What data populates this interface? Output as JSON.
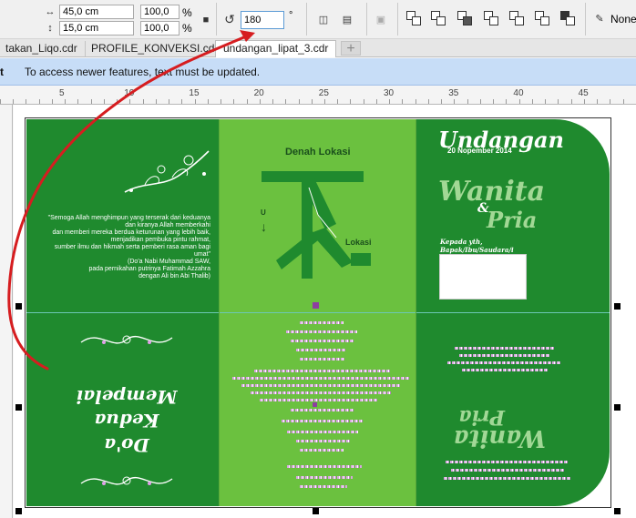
{
  "property_bar": {
    "width_value": "45,0 cm",
    "height_value": "15,0 cm",
    "scale_x": "100,0",
    "scale_y": "100,0",
    "percent_symbol": "%",
    "rotation_value": "180",
    "degree_symbol": "°",
    "none_label": "None"
  },
  "tabs": {
    "items": [
      {
        "label": "takan_Liqo.cdr"
      },
      {
        "label": "PROFILE_KONVEKSI.cdr"
      },
      {
        "label": "undangan_lipat_3.cdr"
      }
    ],
    "add_label": "+"
  },
  "infobar": {
    "prefix": "t",
    "message": "To access newer features, text must be updated."
  },
  "ruler": {
    "labels": [
      "5",
      "10",
      "15",
      "20",
      "25",
      "30",
      "35",
      "40",
      "45"
    ]
  },
  "design": {
    "colors": {
      "dark_green": "#1f8a2e",
      "light_green": "#6bc13f",
      "red_arrow": "#d61d20",
      "purple_handle": "#8d3fa0"
    },
    "doa_text": [
      "\"Semoga Allah  menghimpun yang  terserak dari keduanya",
      "dan kiranya Allah memberkahi",
      "dan memberi mereka berdua keturunan yang lebih baik,",
      "menjadikan pembuka  pintu rahmat,",
      "sumber ilmu dan hikmah serta pemberi rasa  aman bagi umat\"",
      "(Do'a Nabi Muhammad SAW,",
      "pada pernikahan putrinya Fatimah Azzahra",
      "dengan Ali bin Abi Thalib)"
    ],
    "map_title": "Denah Lokasi",
    "map_north": "U",
    "map_location": "Lokasi",
    "invitation_title": "Undangan",
    "invitation_date": "20 Nopember 2014",
    "bride_name": "Wanita",
    "and_symbol": "&",
    "groom_name": "Pria",
    "to_label": "Kepada yth,",
    "to_sub": "Bapak/Ibu/Saudara/i",
    "doa_title_1": "Do'a",
    "doa_title_2": "Kedua",
    "doa_title_3": "Mempelai",
    "back_bride": "Wanita",
    "back_groom": "Pria"
  }
}
